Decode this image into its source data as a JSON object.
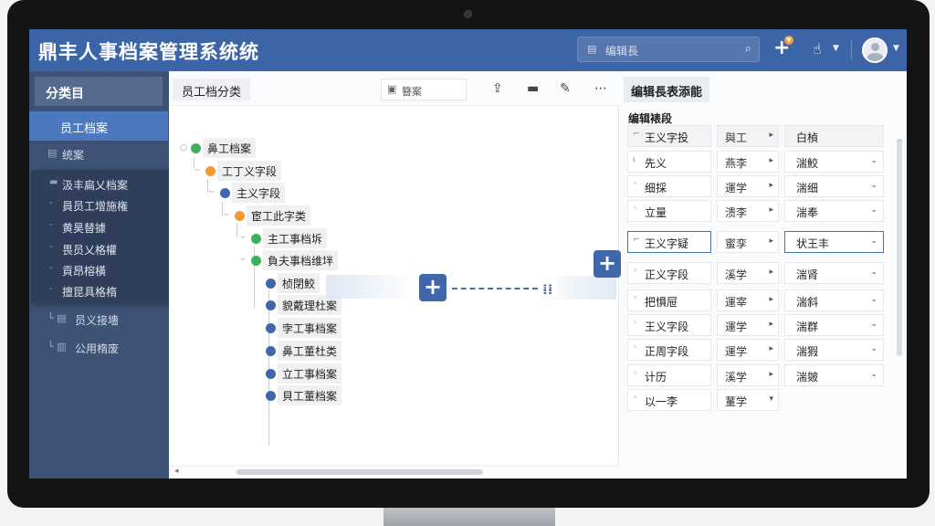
{
  "app": {
    "title": "鼎丰人事档案管理系统统",
    "search_placeholder": "编辑長",
    "add_icon": "plus-icon",
    "tools_icon": "tools-icon",
    "notification_badge": "▼"
  },
  "sidebar": {
    "header": "分类目",
    "active_item": "员工档案",
    "item_files": "统案",
    "group_items": [
      "汲丰扁乂档案",
      "員员工增施権",
      "黄昊替據",
      "畏员乂格權",
      "貢昂榕橫",
      "擅昆具格楕"
    ],
    "item_fields": "员义接墻",
    "item_common": "公用楕废"
  },
  "middle": {
    "title": "员工档分类",
    "search_label": "簪案",
    "tree": {
      "n1": "鼻工档案",
      "n2": "工丁义字段",
      "n3": "主义字段",
      "n4": "宦工此字类",
      "n5": "主工事档坼",
      "n6": "負夫事档维坢",
      "n7": "桢閉鮫",
      "n8": "貌戴理杜案",
      "n9": "孛工事档案",
      "n10": "鼻工董杜类",
      "n11": "立工事档案",
      "n12": "貝工董档案"
    },
    "flow_mid_glyph": "⁞⁞"
  },
  "right": {
    "tab": "编辑長表添能",
    "subtitle": "编辑裱段",
    "rows": [
      {
        "c1": "王义字投",
        "c2": "與工",
        "c3": "白楨",
        "pre": "⌐"
      },
      {
        "c1": "先义",
        "c2": "燕李",
        "c3": "湍鮫",
        "pre": "ι"
      },
      {
        "c1": "细採",
        "c2": "運学",
        "c3": "湍细",
        "pre": "◦"
      },
      {
        "c1": "立量",
        "c2": "溃李",
        "c3": "湍奉",
        "pre": "◦"
      },
      {
        "c1": "王义字疑",
        "c2": "蜜孪",
        "c3": "状王丰",
        "pre": "⌐"
      },
      {
        "c1": "正义字段",
        "c2": "溪学",
        "c3": "湍肾",
        "pre": "◦"
      },
      {
        "c1": "把惧屉",
        "c2": "運宰",
        "c3": "湍斜",
        "pre": "◦"
      },
      {
        "c1": "王义字段",
        "c2": "運学",
        "c3": "湍群",
        "pre": "◦"
      },
      {
        "c1": "正周字段",
        "c2": "運学",
        "c3": "湍猳",
        "pre": "◦"
      },
      {
        "c1": "计历",
        "c2": "溪学",
        "c3": "湍皴",
        "pre": "◦"
      },
      {
        "c1": "以一李",
        "c2": "蓳学",
        "c3": "",
        "pre": "◦"
      }
    ]
  }
}
